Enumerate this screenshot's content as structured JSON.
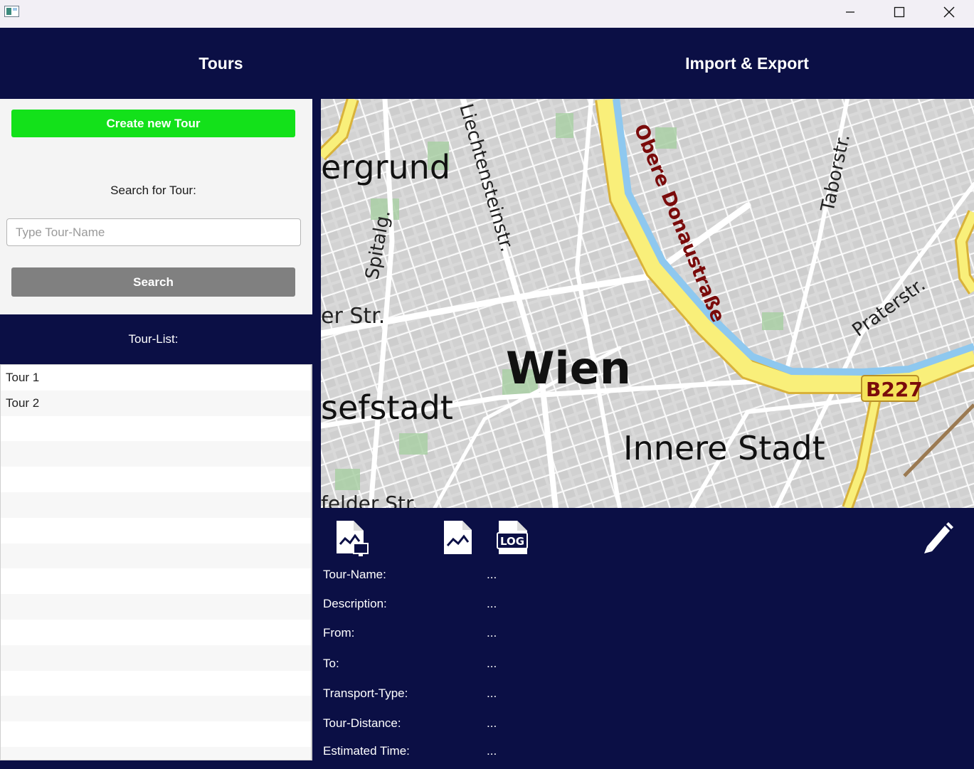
{
  "window": {
    "minimize_icon": "minimize-icon",
    "maximize_icon": "maximize-icon",
    "close_icon": "close-icon"
  },
  "header": {
    "tours_title": "Tours",
    "import_export_title": "Import & Export"
  },
  "left": {
    "create_button": "Create new Tour",
    "search_label": "Search for Tour:",
    "search_placeholder": "Type Tour-Name",
    "search_value": "",
    "search_button": "Search",
    "tour_list_label": "Tour-List:",
    "tours": [
      "Tour 1",
      "Tour 2"
    ]
  },
  "map": {
    "labels": {
      "ergrund": "ergrund",
      "liechtenstein": "Liechtensteinstr.",
      "spitalg": "Spitalg.",
      "erstr": "er Str.",
      "wien": "Wien",
      "sefstadt": "sefstadt",
      "innere": "Innere Stadt",
      "obere": "Obere Donaustraße",
      "taborstr": "Taborstr.",
      "praterstr": "Praterstr.",
      "b227": "B227",
      "felder": "felder Str."
    },
    "colors": {
      "background": "#e2e2e2",
      "road": "#ffffff",
      "major_road": "#f9ef7a",
      "major_road_edge": "#d9b23a",
      "water": "#9fd2f2",
      "park": "#9fc99b",
      "label": "#111111",
      "river_label": "#7a0b0b"
    }
  },
  "details": {
    "icons": [
      "report-icon",
      "summary-report-icon",
      "log-icon",
      "edit-icon"
    ],
    "fields": [
      {
        "label": "Tour-Name:",
        "value": "..."
      },
      {
        "label": "Description:",
        "value": "..."
      },
      {
        "label": "From:",
        "value": "..."
      },
      {
        "label": "To:",
        "value": "..."
      },
      {
        "label": "Transport-Type:",
        "value": "..."
      },
      {
        "label": "Tour-Distance:",
        "value": "..."
      },
      {
        "label": "Estimated Time:",
        "value": "..."
      }
    ]
  },
  "colors": {
    "navy": "#0b0f45",
    "create_green": "#13e11a",
    "search_gray": "#808080"
  }
}
